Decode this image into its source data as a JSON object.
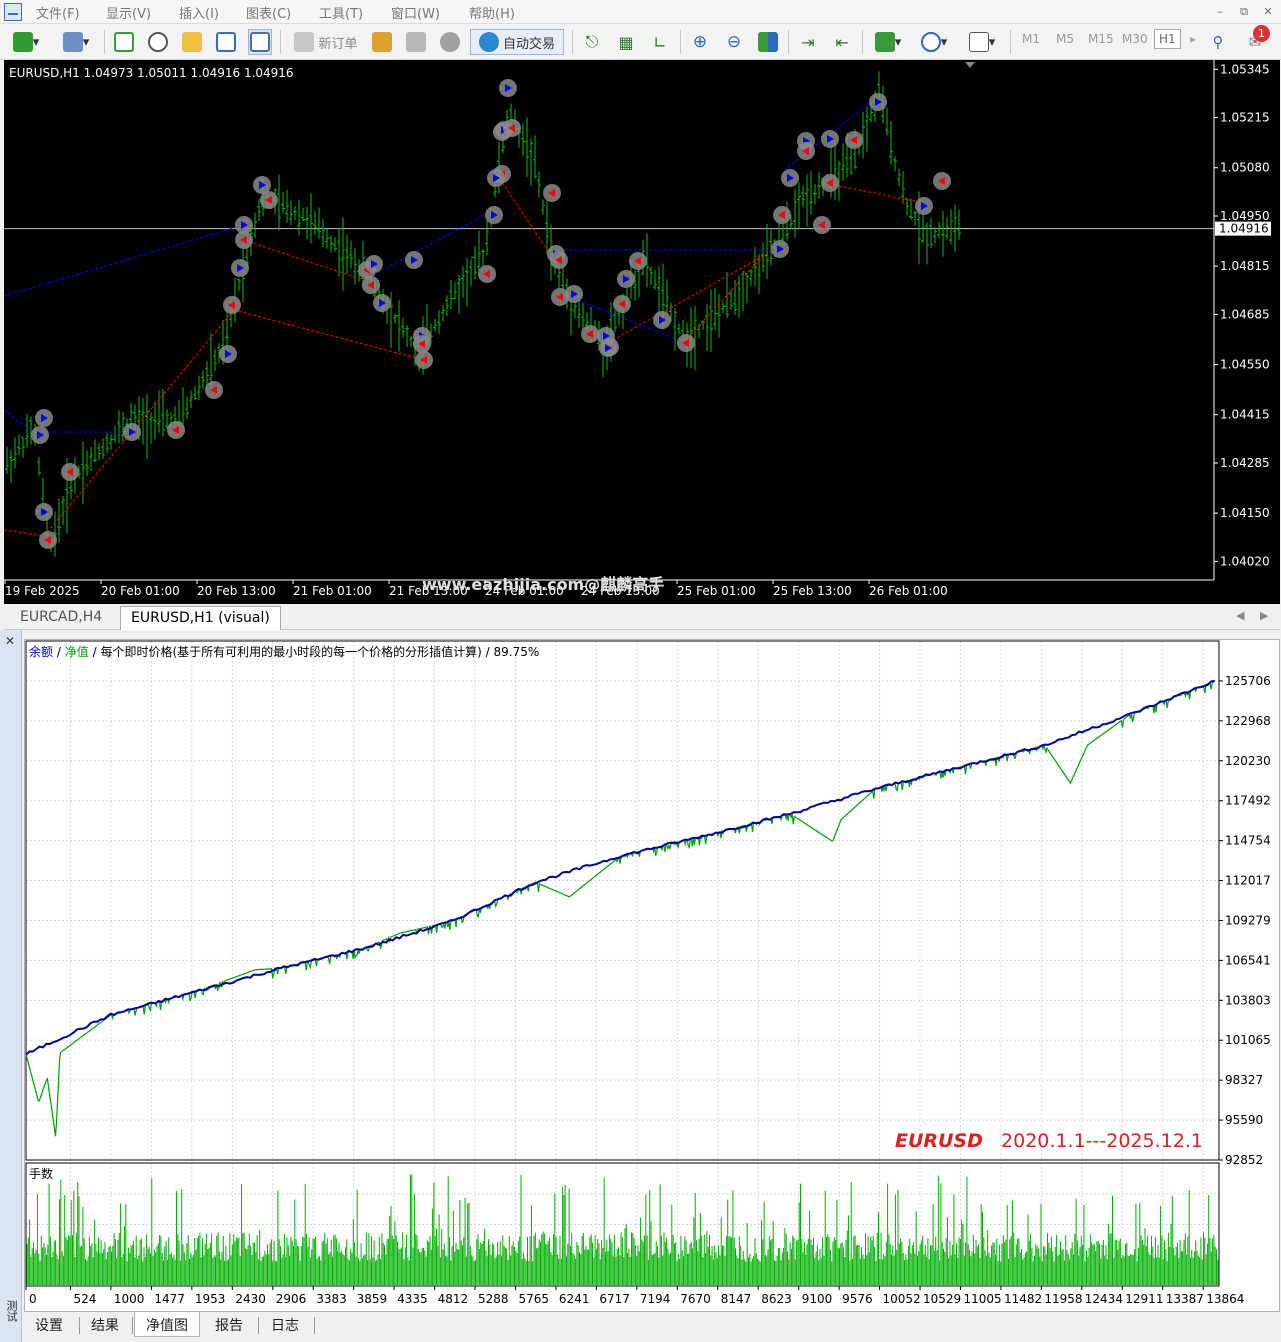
{
  "menu": {
    "items": [
      "文件(F)",
      "显示(V)",
      "插入(I)",
      "图表(C)",
      "工具(T)",
      "窗口(W)",
      "帮助(H)"
    ]
  },
  "toolbar": {
    "new_order_label": "新订单",
    "auto_trading_label": "自动交易",
    "timeframes": [
      "M1",
      "M5",
      "M15",
      "M30",
      "H1"
    ],
    "notification_count": "1",
    "icons": [
      "new-chart-icon",
      "profiles-icon",
      "market-watch-icon",
      "crosshair-icon",
      "navigator-icon",
      "terminal-icon",
      "strategy-tester-icon",
      "new-order-icon",
      "metaeditor-icon",
      "signals-icon",
      "market-icon",
      "auto-trading-icon",
      "bar-chart-icon",
      "candlestick-icon",
      "line-chart-icon",
      "zoom-in-icon",
      "zoom-out-icon",
      "tile-windows-icon",
      "autoscroll-icon",
      "chart-shift-icon",
      "indicators-icon",
      "periods-icon",
      "templates-icon",
      "search-icon",
      "notification-icon"
    ]
  },
  "chart": {
    "info": "EURUSD,H1  1.04973 1.05011 1.04916 1.04916",
    "symbol": "EURUSD",
    "timeframe": "H1",
    "ohlc": {
      "open": 1.04973,
      "high": 1.05011,
      "low": 1.04916,
      "close": 1.04916
    },
    "bid_label": "1.04916",
    "bid": 1.04916,
    "price_labels": [
      "1.05345",
      "1.05215",
      "1.05080",
      "1.04950",
      "1.04815",
      "1.04685",
      "1.04550",
      "1.04415",
      "1.04285",
      "1.04150",
      "1.04020"
    ],
    "price_range": [
      1.0397,
      1.0537
    ],
    "time_labels": [
      "19 Feb 2025",
      "20 Feb 01:00",
      "20 Feb 13:00",
      "21 Feb 01:00",
      "21 Feb 13:00",
      "24 Feb 01:00",
      "24 Feb 13:00",
      "25 Feb 01:00",
      "25 Feb 13:00",
      "26 Feb 01:00"
    ],
    "watermark": "www.eazhijia.com@麒麟高手",
    "colors": {
      "bars": "#00c000",
      "buy": "#0000ff",
      "sell": "#ff0000"
    }
  },
  "chart_tabs": {
    "items": [
      "EURCAD,H4",
      "EURUSD,H1 (visual)"
    ],
    "active": 1
  },
  "tester": {
    "side_label": "测试",
    "legend": {
      "balance": "余额",
      "sep1": "/",
      "equity": "净值",
      "sep2": "/",
      "model": "每个即时价格(基于所有可利用的最小时段的每一个价格的分形插值计算)",
      "sep3": "/",
      "quality": "89.75%"
    },
    "lots_label": "手数",
    "range_symbol": "EURUSD",
    "range_dates": "2020.1.1---2025.12.1",
    "tabs": [
      "设置",
      "结果",
      "净值图",
      "报告",
      "日志"
    ],
    "active_tab": 2
  },
  "chart_data": {
    "type": "line",
    "title": "",
    "series": [
      {
        "name": "余额",
        "color": "#0000a0",
        "x": [
          0,
          1000,
          2000,
          3000,
          4000,
          5000,
          6000,
          7000,
          8000,
          9000,
          10000,
          11000,
          12000,
          13000,
          14000
        ],
        "y": [
          100100,
          102800,
          104400,
          106000,
          107400,
          109200,
          111900,
          113700,
          115100,
          116600,
          118300,
          119800,
          121300,
          123400,
          125700
        ]
      },
      {
        "name": "净值",
        "color": "#00a000",
        "x": [
          0,
          150,
          250,
          350,
          400,
          1000,
          2000,
          2700,
          3000,
          4000,
          4400,
          5000,
          6000,
          6400,
          7000,
          8000,
          9000,
          9500,
          9600,
          10000,
          11000,
          12000,
          12300,
          12500,
          13000,
          14000
        ],
        "y": [
          100100,
          96800,
          98500,
          94400,
          100200,
          102800,
          104400,
          105900,
          106000,
          107400,
          108400,
          109200,
          111900,
          110900,
          113700,
          115100,
          116600,
          114700,
          116200,
          118300,
          119800,
          121300,
          118700,
          121300,
          123400,
          125700
        ]
      }
    ],
    "volume": {
      "name": "手数",
      "color": "#00b000",
      "x": [
        0,
        14000
      ],
      "levels": [
        0.2,
        0.95
      ]
    },
    "x_ticks": [
      0,
      524,
      1000,
      1477,
      1953,
      2430,
      2906,
      3383,
      3859,
      4335,
      4812,
      5288,
      5765,
      6241,
      6717,
      7194,
      7670,
      8147,
      8623,
      9100,
      9576,
      10052,
      10529,
      11005,
      11482,
      11958,
      12434,
      12911,
      13387,
      13864
    ],
    "x_tick_labels": [
      "0",
      "524",
      "1000",
      "1477",
      "1953",
      "2430",
      "2906",
      "3383",
      "3859",
      "4335",
      "4812",
      "5288",
      "5765",
      "6241",
      "6717",
      "7194",
      "7670",
      "8147",
      "8623",
      "9100",
      "9576",
      "10052",
      "10529",
      "11005",
      "11482",
      "11958",
      "12434",
      "12911",
      "13387",
      "13864"
    ],
    "y_ticks": [
      125706,
      122968,
      120230,
      117492,
      114754,
      112017,
      109279,
      106541,
      103803,
      101065,
      98327,
      95590,
      92852
    ],
    "y_tick_labels": [
      "125706",
      "122968",
      "120230",
      "117492",
      "114754",
      "112017",
      "109279",
      "106541",
      "103803",
      "101065",
      "98327",
      "95590",
      "92852"
    ],
    "xlim": [
      0,
      14050
    ],
    "ylim": [
      92852,
      128444
    ],
    "grid": true
  }
}
